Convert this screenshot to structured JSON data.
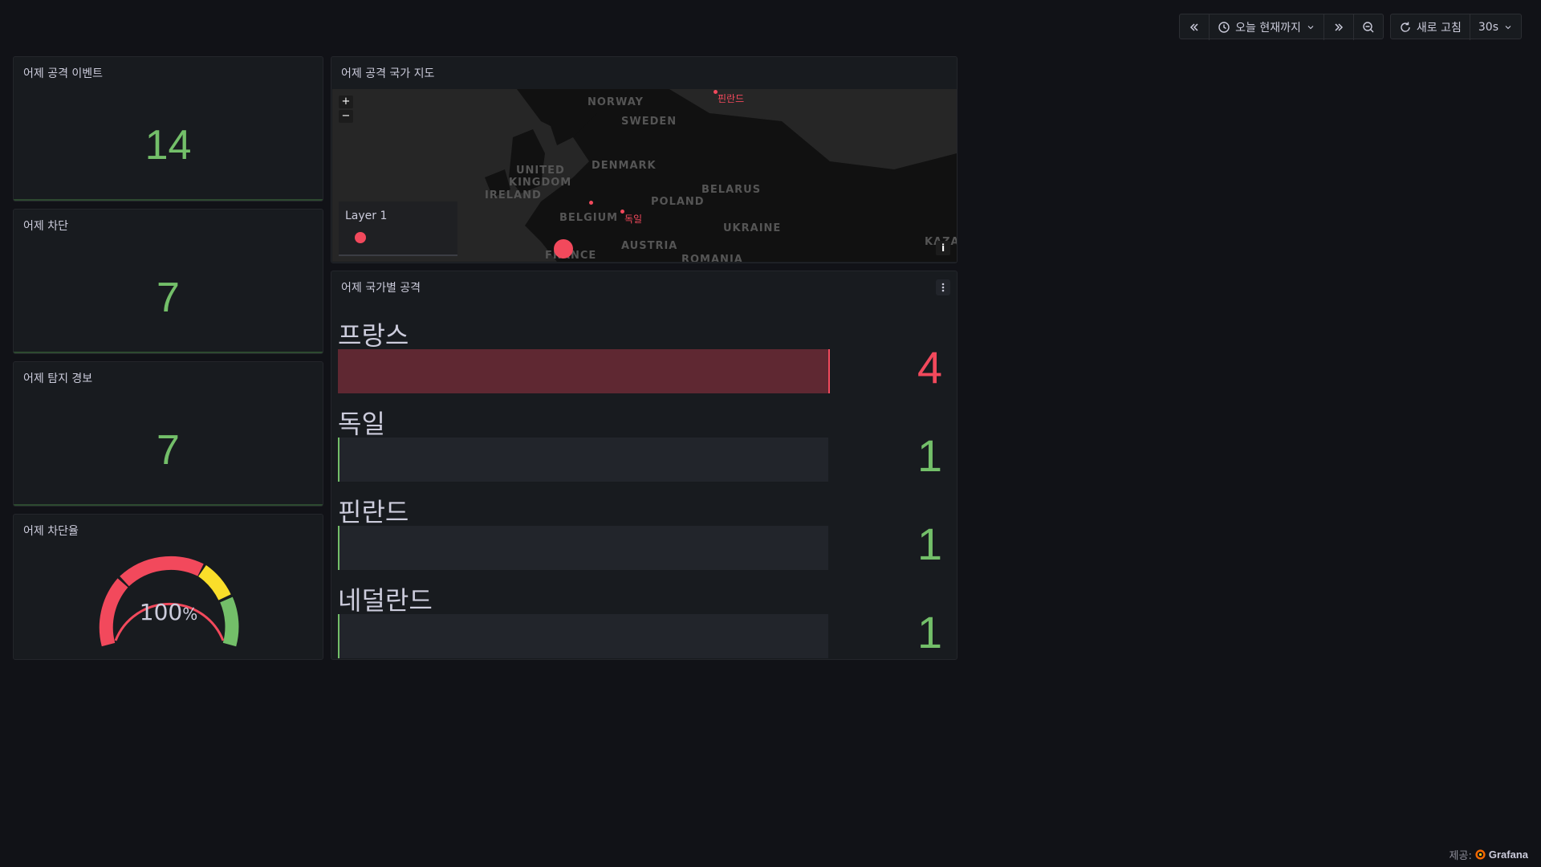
{
  "toolbar": {
    "time_range_label": "오늘 현재까지",
    "refresh_label": "새로 고침",
    "refresh_interval": "30s"
  },
  "stat_panels": [
    {
      "title": "어제 공격 이벤트",
      "value": "14"
    },
    {
      "title": "어제 차단",
      "value": "7"
    },
    {
      "title": "어제 탐지 경보",
      "value": "7"
    }
  ],
  "gauge_panel": {
    "title": "어제 차단율",
    "value": "100",
    "unit": "%",
    "value_fraction": 1.0
  },
  "map_panel": {
    "title": "어제 공격 국가 지도",
    "legend_title": "Layer 1",
    "zoom_in": "+",
    "zoom_out": "−",
    "info": "i",
    "countries": [
      "NORWAY",
      "SWEDEN",
      "UNITED",
      "KINGDOM",
      "IRELAND",
      "DENMARK",
      "BELARUS",
      "POLAND",
      "BELGIUM",
      "UKRAINE",
      "AUSTRIA",
      "ROMANIA",
      "FRANCE",
      "KAZA"
    ],
    "markers": [
      "핀란드",
      "독일"
    ]
  },
  "bar_panel": {
    "title": "어제 국가별 공격",
    "rows": [
      {
        "name": "프랑스",
        "value": 4,
        "color": "#f2495c"
      },
      {
        "name": "독일",
        "value": 1,
        "color": "#73bf69"
      },
      {
        "name": "핀란드",
        "value": 1,
        "color": "#73bf69"
      },
      {
        "name": "네덜란드",
        "value": 1,
        "color": "#73bf69"
      }
    ]
  },
  "footer": {
    "prefix": "제공:",
    "brand": "Grafana"
  },
  "colors": {
    "green": "#73bf69",
    "red": "#f2495c",
    "yellow": "#fade2a"
  }
}
